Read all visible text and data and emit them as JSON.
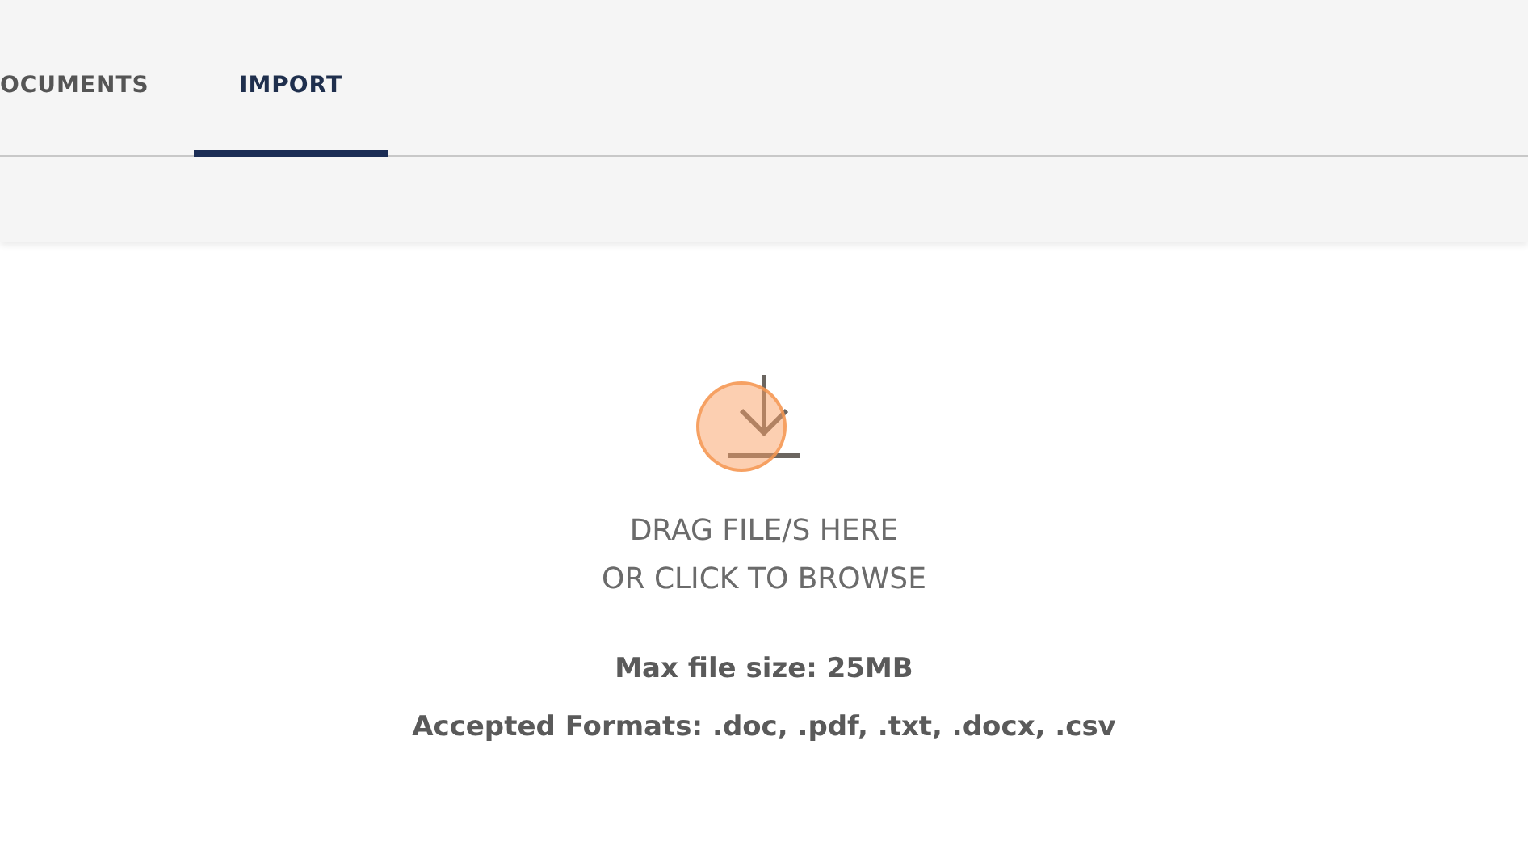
{
  "tabs": [
    {
      "label": "OCUMENTS",
      "selected": false
    },
    {
      "label": "IMPORT",
      "selected": true
    }
  ],
  "dropzone": {
    "lines": [
      "DRAG FILE/S HERE",
      "OR CLICK TO BROWSE"
    ],
    "max_size": "Max file size: 25MB",
    "formats": "Accepted Formats: .doc, .pdf, .txt, .docx, .csv"
  }
}
